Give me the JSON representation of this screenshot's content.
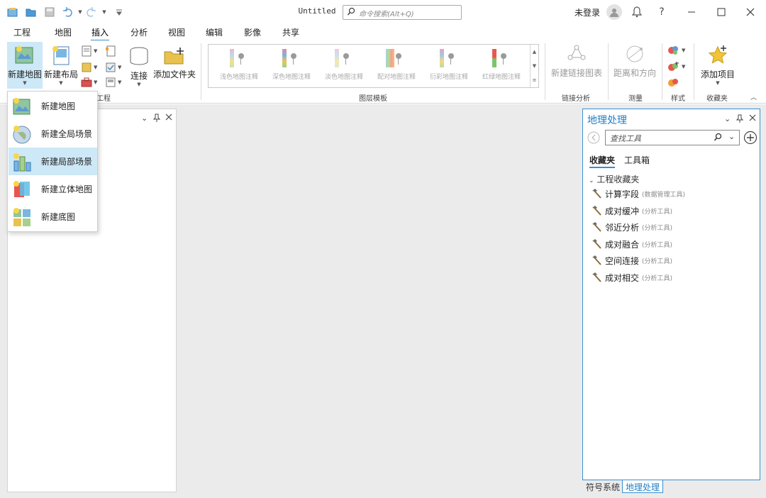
{
  "titlebar": {
    "doc_title": "Untitled",
    "search_placeholder": "命令搜索(Alt+Q)",
    "login": "未登录",
    "help": "?"
  },
  "tabs": [
    "工程",
    "地图",
    "插入",
    "分析",
    "视图",
    "编辑",
    "影像",
    "共享"
  ],
  "active_tab": "插入",
  "ribbon": {
    "new_map": "新建地图",
    "new_layout": "新建布局",
    "connect": "连接",
    "add_folder": "添加文件夹",
    "project_group_partial": "工程",
    "gallery": [
      "浅色地图注释",
      "深色地图注释",
      "淡色地图注释",
      "配对地图注释",
      "衍彩地图注释",
      "红绿地图注释"
    ],
    "layer_templates": "图层模板",
    "new_link_chart": "新建链接图表",
    "link_analysis": "链接分析",
    "distance_direction": "距离和方向",
    "measure": "测量",
    "styles": "样式",
    "add_item": "添加项目",
    "favorites": "收藏夹"
  },
  "dropdown": {
    "items": [
      "新建地图",
      "新建全局场景",
      "新建局部场景",
      "新建立体地图",
      "新建底图"
    ],
    "highlighted_index": 2
  },
  "geoprocessing": {
    "title": "地理处理",
    "search_placeholder": "查找工具",
    "tabs": [
      "收藏夹",
      "工具箱"
    ],
    "section": "工程收藏夹",
    "tools": [
      {
        "name": "计算字段",
        "toolbox": "(数据管理工具)"
      },
      {
        "name": "成对缓冲",
        "toolbox": "(分析工具)"
      },
      {
        "name": "邻近分析",
        "toolbox": "(分析工具)"
      },
      {
        "name": "成对融合",
        "toolbox": "(分析工具)"
      },
      {
        "name": "空间连接",
        "toolbox": "(分析工具)"
      },
      {
        "name": "成对相交",
        "toolbox": "(分析工具)"
      }
    ]
  },
  "bottom_tabs": [
    "符号系统",
    "地理处理"
  ],
  "colors": {
    "accent": "#3b8fcb",
    "panel_border": "#3a8fd0",
    "highlight": "#cde8f6"
  }
}
